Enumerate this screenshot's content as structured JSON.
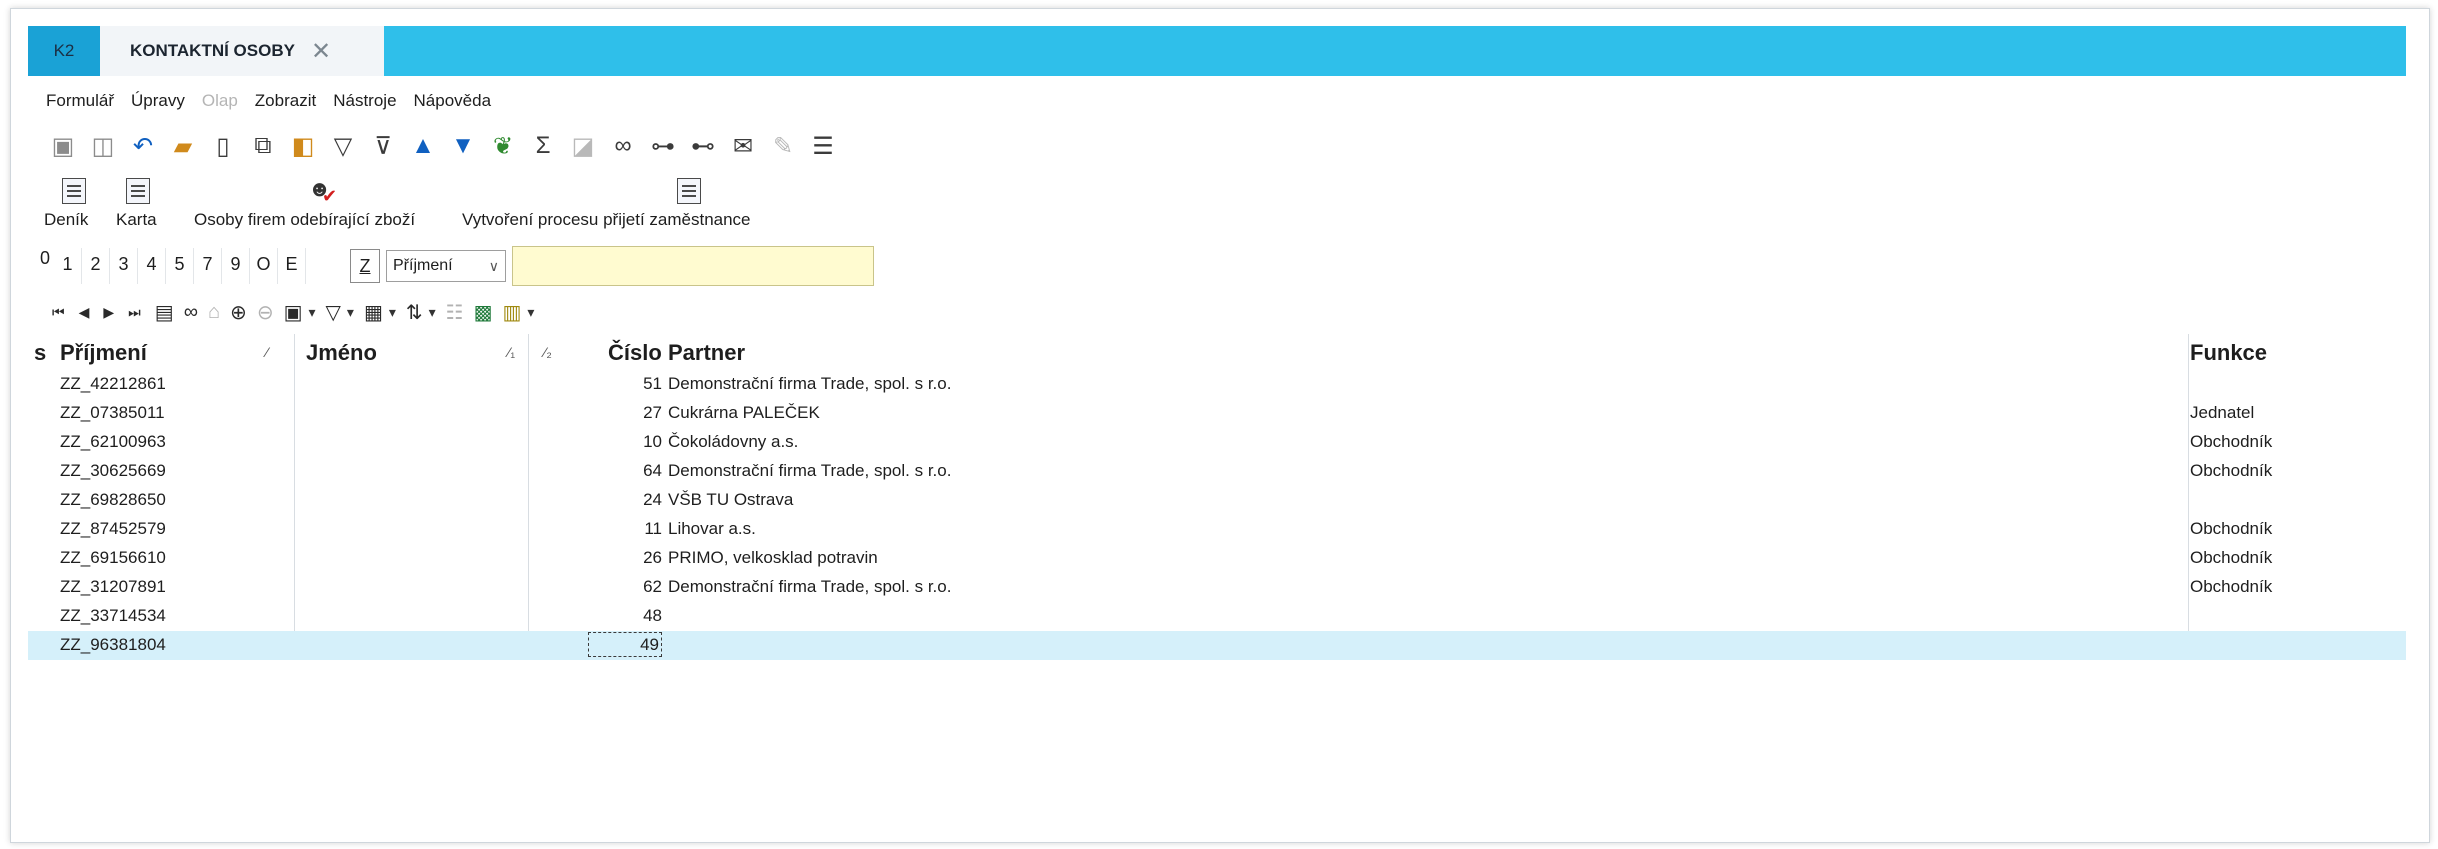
{
  "tabs": {
    "app_tab": "K2",
    "doc_tab": "KONTAKTNÍ OSOBY",
    "close_glyph": "✕"
  },
  "menu": [
    "Formulář",
    "Úpravy",
    "Olap",
    "Zobrazit",
    "Nástroje",
    "Nápověda"
  ],
  "menu_disabled": [
    "Olap"
  ],
  "toolbar_icons": [
    "save-icon",
    "save-as-icon",
    "undo-icon",
    "open-folder-icon",
    "new-document-icon",
    "copy-icon",
    "book-icon",
    "filter-icon",
    "filter-edit-icon",
    "arrow-up-icon",
    "arrow-down-icon",
    "tree-icon",
    "sum-icon",
    "batch-icon",
    "binoculars-icon",
    "find-next-icon",
    "find-prev-icon",
    "mail-icon",
    "edit-icon",
    "hamburger-menu-icon"
  ],
  "actions": {
    "denik": "Deník",
    "karta": "Karta",
    "osoby": "Osoby firem odebírající zboží",
    "proces": "Vytvoření procesu přijetí zaměstnance"
  },
  "filters": {
    "tabs": [
      "0",
      "1",
      "2",
      "3",
      "4",
      "5",
      "7",
      "9",
      "O",
      "E"
    ],
    "z_button": "Z",
    "select_value": "Příjmení",
    "input_value": ""
  },
  "navbar_icons": [
    "first-record-icon",
    "prev-record-icon",
    "next-record-icon",
    "last-record-icon",
    "report-icon",
    "binoculars-icon",
    "tag-icon",
    "hierarchy-add-icon",
    "hierarchy-icon",
    "folder-icon",
    "filter-icon",
    "columns-icon",
    "sort-icon",
    "list-icon",
    "excel-icon",
    "calculator-icon"
  ],
  "grid": {
    "headers": {
      "s": "s",
      "prijmeni": "Příjmení",
      "prijmeni_sort": "⁄",
      "jmeno": "Jméno",
      "jmeno_sort": "⁄₁",
      "extra_sort": "⁄₂",
      "cislo": "Číslo",
      "partner": "Partner",
      "funkce": "Funkce"
    },
    "rows": [
      {
        "prijmeni": "ZZ_42212861",
        "cislo": "51",
        "partner": "Demonstrační firma Trade, spol. s r.o.",
        "funkce": ""
      },
      {
        "prijmeni": "ZZ_07385011",
        "cislo": "27",
        "partner": "Cukrárna PALEČEK",
        "funkce": "Jednatel"
      },
      {
        "prijmeni": "ZZ_62100963",
        "cislo": "10",
        "partner": "Čokoládovny a.s.",
        "funkce": "Obchodník"
      },
      {
        "prijmeni": "ZZ_30625669",
        "cislo": "64",
        "partner": "Demonstrační firma Trade, spol. s r.o.",
        "funkce": "Obchodník"
      },
      {
        "prijmeni": "ZZ_69828650",
        "cislo": "24",
        "partner": "VŠB TU Ostrava",
        "funkce": ""
      },
      {
        "prijmeni": "ZZ_87452579",
        "cislo": "11",
        "partner": "Lihovar a.s.",
        "funkce": "Obchodník"
      },
      {
        "prijmeni": "ZZ_69156610",
        "cislo": "26",
        "partner": "PRIMO, velkosklad potravin",
        "funkce": "Obchodník"
      },
      {
        "prijmeni": "ZZ_31207891",
        "cislo": "62",
        "partner": "Demonstrační firma Trade, spol. s r.o.",
        "funkce": "Obchodník"
      },
      {
        "prijmeni": "ZZ_33714534",
        "cislo": "48",
        "partner": "",
        "funkce": ""
      },
      {
        "prijmeni": "ZZ_96381804",
        "cislo": "49",
        "partner": "",
        "funkce": ""
      }
    ],
    "selected_index": 9
  },
  "colors": {
    "tabbar": "#2fbfea",
    "app_tab": "#1aa2d6",
    "selected_row": "#d5f0fa",
    "filter_input": "#fffbd0"
  }
}
